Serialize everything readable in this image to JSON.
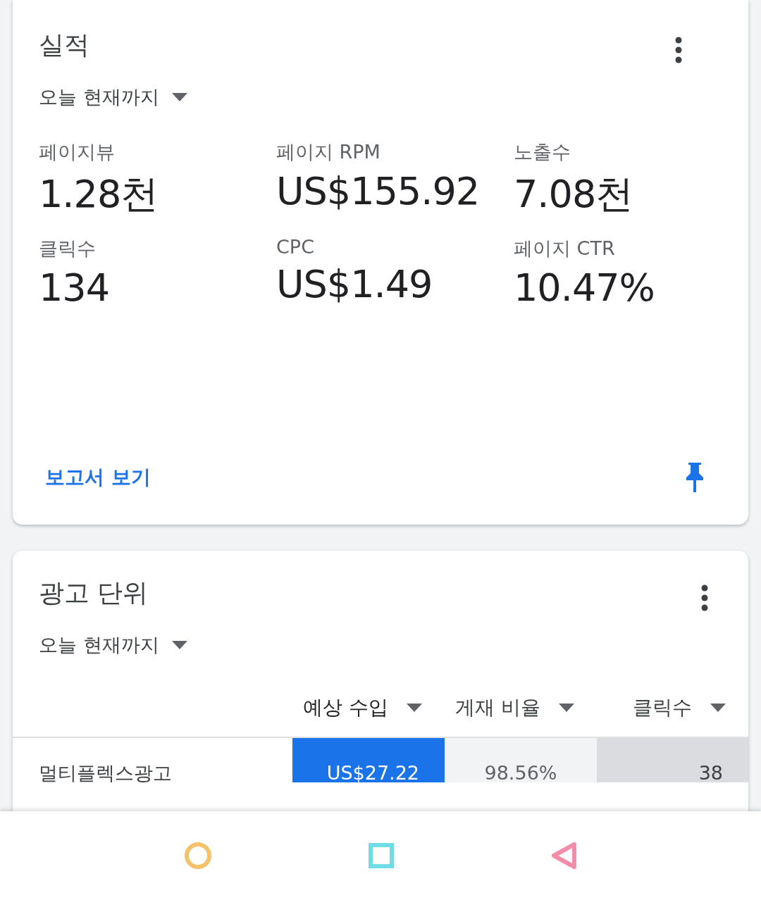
{
  "performance": {
    "title": "실적",
    "period": "오늘 현재까지",
    "metrics": [
      {
        "label": "페이지뷰",
        "value": "1.28천"
      },
      {
        "label": "페이지 RPM",
        "value": "US$155.92"
      },
      {
        "label": "노출수",
        "value": "7.08천"
      },
      {
        "label": "클릭수",
        "value": "134"
      },
      {
        "label": "CPC",
        "value": "US$1.49"
      },
      {
        "label": "페이지 CTR",
        "value": "10.47%"
      }
    ],
    "link": "보고서 보기",
    "pinned": true
  },
  "ad_units": {
    "title": "광고 단위",
    "period": "오늘 현재까지",
    "columns": [
      {
        "label": "예상 수입",
        "selected": true
      },
      {
        "label": "게재 비율",
        "selected": false
      },
      {
        "label": "클릭수",
        "selected": false
      }
    ],
    "rows": [
      {
        "name": "멀티플렉스광고",
        "cells": [
          "US$27.22",
          "98.56%",
          "38"
        ]
      }
    ]
  }
}
